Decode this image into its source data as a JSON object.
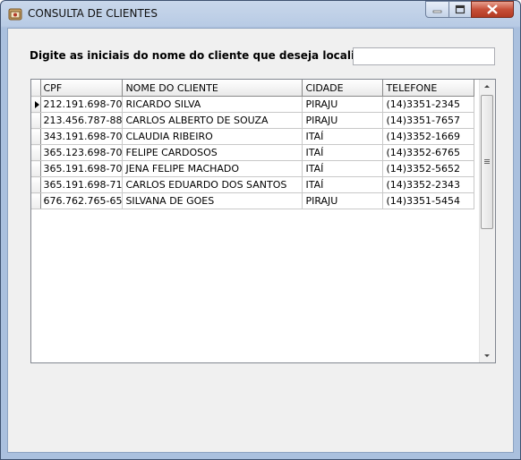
{
  "window": {
    "title": "CONSULTA DE CLIENTES",
    "icon": "app-icon"
  },
  "search": {
    "label": "Digite as iniciais do nome do cliente que deseja localizar:",
    "value": ""
  },
  "grid": {
    "columns": [
      "CPF",
      "NOME DO CLIENTE",
      "CIDADE",
      "TELEFONE"
    ],
    "rows": [
      [
        "212.191.698-70",
        "RICARDO SILVA",
        "PIRAJU",
        "(14)3351-2345"
      ],
      [
        "213.456.787-88",
        "CARLOS ALBERTO DE SOUZA",
        "PIRAJU",
        "(14)3351-7657"
      ],
      [
        "343.191.698-70",
        "CLAUDIA RIBEIRO",
        "ITAÍ",
        "(14)3352-1669"
      ],
      [
        "365.123.698-70",
        "FELIPE CARDOSOS",
        "ITAÍ",
        "(14)3352-6765"
      ],
      [
        "365.191.698-70",
        "JENA FELIPE MACHADO",
        "ITAÍ",
        "(14)3352-5652"
      ],
      [
        "365.191.698-71",
        "CARLOS EDUARDO DOS SANTOS",
        "ITAÍ",
        "(14)3352-2343"
      ],
      [
        "676.762.765-65",
        "SILVANA DE GOES",
        "PIRAJU",
        "(14)3351-5454"
      ]
    ]
  }
}
